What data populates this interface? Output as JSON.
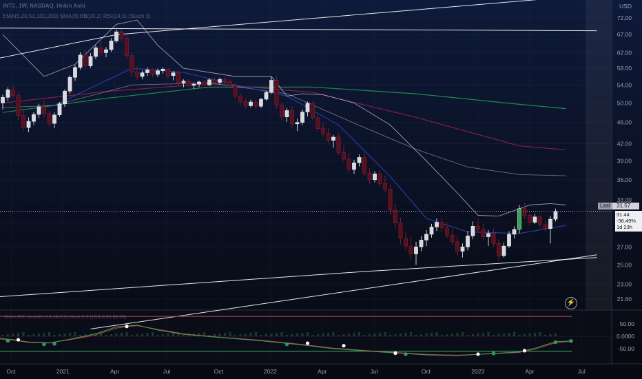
{
  "header": {
    "title": "INTC, 1W, NASDAQ, Hnkin Ashi",
    "indicators": "EMA(5,20,50,100,200) SMA(8) BB(20,2) RSI(14,5) (Stoch 3)",
    "osc_label": "Stoch RSI smooth (14,14,3,3) close 2.3 (16.4 0.00 50.00)"
  },
  "currency": "USD",
  "last_price": {
    "label": "Last",
    "value": "31.57"
  },
  "info_box": {
    "price": "31.44",
    "change": "-36.49%",
    "countdown": "1d 23h"
  },
  "y_ticks": [
    "72.00",
    "67.00",
    "62.00",
    "58.00",
    "54.00",
    "50.00",
    "46.00",
    "42.00",
    "39.00",
    "36.00",
    "33.00",
    "30.00",
    "27.00",
    "25.00",
    "23.00",
    "21.60"
  ],
  "y_tick_values": [
    72,
    67,
    62,
    58,
    54,
    50,
    46,
    42,
    39,
    36,
    33,
    30,
    27,
    25,
    23,
    21.6
  ],
  "osc_ticks": [
    "50.00",
    "0.0000",
    "-50.00"
  ],
  "x_ticks": [
    "Oct",
    "2021",
    "Apr",
    "Jul",
    "Oct",
    "2022",
    "Apr",
    "Jul",
    "Oct",
    "2023",
    "Apr",
    "Jul"
  ],
  "chart_data": {
    "type": "candlestick",
    "symbol": "INTC",
    "interval": "1W",
    "exchange": "NASDAQ",
    "price_scale": "log",
    "ylim": [
      20.6,
      77
    ],
    "x_start_week": 0,
    "candles": [
      [
        50.0,
        51.8,
        48.6,
        51.2
      ],
      [
        51.2,
        53.5,
        50.4,
        52.9
      ],
      [
        52.9,
        54.0,
        51.0,
        51.6
      ],
      [
        51.6,
        52.2,
        46.5,
        47.4
      ],
      [
        47.4,
        48.5,
        44.2,
        45.0
      ],
      [
        45.0,
        47.0,
        44.1,
        46.2
      ],
      [
        46.2,
        48.1,
        45.5,
        47.6
      ],
      [
        47.6,
        49.8,
        46.9,
        49.2
      ],
      [
        49.2,
        50.5,
        47.0,
        47.8
      ],
      [
        47.8,
        48.3,
        45.1,
        45.8
      ],
      [
        45.8,
        48.0,
        44.9,
        47.5
      ],
      [
        47.5,
        50.2,
        47.1,
        49.8
      ],
      [
        49.8,
        53.0,
        49.2,
        52.6
      ],
      [
        52.6,
        56.3,
        52.0,
        55.8
      ],
      [
        55.8,
        58.8,
        55.0,
        58.2
      ],
      [
        58.2,
        62.1,
        57.6,
        61.4
      ],
      [
        61.4,
        62.8,
        57.8,
        58.6
      ],
      [
        58.6,
        61.9,
        58.1,
        61.0
      ],
      [
        61.0,
        64.0,
        60.3,
        63.3
      ],
      [
        63.3,
        65.1,
        61.2,
        62.0
      ],
      [
        62.0,
        63.5,
        60.8,
        62.8
      ],
      [
        62.8,
        66.0,
        62.2,
        65.2
      ],
      [
        65.2,
        68.4,
        64.7,
        67.8
      ],
      [
        67.8,
        68.5,
        65.1,
        66.0
      ],
      [
        66.0,
        67.0,
        60.3,
        61.2
      ],
      [
        61.2,
        62.0,
        56.0,
        57.1
      ],
      [
        57.1,
        58.5,
        55.2,
        56.0
      ],
      [
        56.0,
        57.4,
        55.3,
        56.9
      ],
      [
        56.9,
        58.2,
        56.1,
        57.6
      ],
      [
        57.6,
        58.0,
        55.8,
        56.5
      ],
      [
        56.5,
        57.9,
        55.9,
        57.4
      ],
      [
        57.4,
        58.3,
        56.7,
        57.8
      ],
      [
        57.8,
        58.1,
        55.5,
        56.2
      ],
      [
        56.2,
        57.3,
        55.1,
        56.9
      ],
      [
        56.9,
        57.2,
        53.9,
        54.5
      ],
      [
        54.5,
        55.3,
        53.5,
        54.9
      ],
      [
        54.9,
        55.5,
        53.2,
        53.9
      ],
      [
        53.9,
        54.6,
        53.0,
        54.2
      ],
      [
        54.2,
        55.0,
        53.5,
        54.7
      ],
      [
        54.7,
        55.1,
        53.7,
        54.0
      ],
      [
        54.0,
        55.6,
        53.8,
        55.2
      ],
      [
        55.2,
        55.8,
        54.0,
        54.6
      ],
      [
        54.6,
        55.7,
        54.1,
        55.3
      ],
      [
        55.3,
        56.0,
        54.2,
        54.8
      ],
      [
        54.8,
        55.4,
        53.2,
        53.8
      ],
      [
        53.8,
        54.5,
        50.9,
        51.5
      ],
      [
        51.5,
        52.2,
        49.5,
        50.3
      ],
      [
        50.3,
        51.0,
        48.8,
        49.4
      ],
      [
        49.4,
        50.7,
        49.0,
        50.2
      ],
      [
        50.2,
        50.8,
        48.7,
        49.3
      ],
      [
        49.3,
        51.1,
        48.9,
        50.8
      ],
      [
        50.8,
        52.7,
        50.5,
        52.3
      ],
      [
        52.3,
        55.9,
        52.0,
        55.1
      ],
      [
        55.1,
        56.1,
        48.8,
        49.6
      ],
      [
        49.6,
        50.1,
        46.4,
        47.1
      ],
      [
        47.1,
        48.9,
        46.1,
        48.4
      ],
      [
        48.4,
        49.3,
        44.8,
        45.7
      ],
      [
        45.7,
        46.7,
        44.3,
        46.0
      ],
      [
        46.0,
        48.6,
        45.5,
        48.1
      ],
      [
        48.1,
        50.3,
        47.2,
        49.9
      ],
      [
        49.9,
        50.4,
        46.4,
        46.9
      ],
      [
        46.9,
        47.6,
        44.2,
        44.8
      ],
      [
        44.8,
        45.9,
        43.3,
        43.9
      ],
      [
        43.9,
        44.9,
        41.9,
        42.6
      ],
      [
        42.6,
        43.6,
        41.3,
        43.2
      ],
      [
        43.2,
        43.9,
        40.0,
        40.4
      ],
      [
        40.4,
        41.7,
        38.9,
        39.3
      ],
      [
        39.3,
        40.3,
        37.1,
        37.6
      ],
      [
        37.6,
        39.2,
        36.9,
        38.7
      ],
      [
        38.7,
        40.1,
        38.1,
        39.6
      ],
      [
        39.6,
        40.5,
        36.6,
        37.0
      ],
      [
        37.0,
        37.8,
        35.3,
        36.0
      ],
      [
        36.0,
        37.3,
        35.6,
        36.9
      ],
      [
        36.9,
        37.6,
        34.9,
        35.4
      ],
      [
        35.4,
        36.7,
        34.1,
        34.6
      ],
      [
        34.6,
        35.3,
        31.0,
        31.6
      ],
      [
        31.6,
        32.5,
        29.2,
        29.9
      ],
      [
        29.9,
        30.6,
        27.3,
        28.0
      ],
      [
        28.0,
        28.9,
        26.6,
        27.1
      ],
      [
        27.1,
        28.1,
        25.5,
        26.2
      ],
      [
        26.2,
        27.6,
        25.0,
        27.0
      ],
      [
        27.0,
        28.3,
        26.5,
        27.8
      ],
      [
        27.8,
        29.0,
        27.1,
        28.5
      ],
      [
        28.5,
        29.8,
        28.1,
        29.4
      ],
      [
        29.4,
        30.5,
        28.9,
        30.0
      ],
      [
        30.0,
        30.6,
        28.8,
        29.3
      ],
      [
        29.3,
        29.9,
        28.0,
        28.4
      ],
      [
        28.4,
        29.2,
        27.2,
        27.6
      ],
      [
        27.6,
        28.3,
        26.0,
        26.5
      ],
      [
        26.5,
        27.4,
        25.8,
        27.0
      ],
      [
        27.0,
        28.9,
        26.6,
        28.3
      ],
      [
        28.3,
        30.1,
        27.9,
        29.5
      ],
      [
        29.5,
        30.4,
        28.7,
        29.1
      ],
      [
        29.1,
        29.8,
        27.8,
        28.2
      ],
      [
        28.2,
        29.0,
        27.1,
        28.6
      ],
      [
        28.6,
        29.2,
        27.0,
        27.4
      ],
      [
        27.4,
        27.9,
        25.4,
        26.0
      ],
      [
        26.0,
        27.5,
        25.8,
        27.1
      ],
      [
        27.1,
        28.9,
        26.9,
        28.5
      ],
      [
        28.5,
        29.5,
        28.0,
        29.1
      ],
      [
        29.1,
        32.3,
        28.6,
        31.8
      ],
      [
        31.8,
        32.6,
        30.4,
        30.9
      ],
      [
        30.9,
        31.2,
        29.6,
        30.0
      ],
      [
        30.0,
        31.1,
        29.8,
        30.7
      ],
      [
        30.7,
        31.0,
        29.3,
        29.7
      ],
      [
        29.7,
        30.2,
        28.9,
        29.2
      ],
      [
        29.2,
        30.8,
        27.4,
        30.4
      ],
      [
        30.4,
        31.8,
        30.1,
        31.44
      ]
    ],
    "series": [
      {
        "kind": "ema-200",
        "values": [
          [
            0,
            48.0
          ],
          [
            20,
            51.0
          ],
          [
            40,
            53.5
          ],
          [
            60,
            53.5
          ],
          [
            80,
            52.0
          ],
          [
            100,
            49.7
          ],
          [
            109,
            48.8
          ]
        ]
      },
      {
        "kind": "ema-100",
        "values": [
          [
            0,
            50.0
          ],
          [
            20,
            52.5
          ],
          [
            40,
            54.3
          ],
          [
            60,
            52.3
          ],
          [
            80,
            47.0
          ],
          [
            100,
            41.6
          ],
          [
            109,
            40.9
          ]
        ]
      },
      {
        "kind": "ema-50",
        "values": [
          [
            0,
            49.0
          ],
          [
            10,
            49.5
          ],
          [
            25,
            54.0
          ],
          [
            40,
            54.5
          ],
          [
            55,
            52.0
          ],
          [
            70,
            45.0
          ],
          [
            80,
            41.0
          ],
          [
            90,
            38.0
          ],
          [
            100,
            36.8
          ],
          [
            109,
            36.6
          ]
        ]
      },
      {
        "kind": "ema-20",
        "values": [
          [
            10,
            49.5
          ],
          [
            25,
            58.0
          ],
          [
            35,
            57.0
          ],
          [
            45,
            54.0
          ],
          [
            55,
            51.5
          ],
          [
            65,
            45.5
          ],
          [
            75,
            36.5
          ],
          [
            82,
            30.5
          ],
          [
            90,
            28.8
          ],
          [
            100,
            28.6
          ],
          [
            109,
            29.6
          ]
        ]
      },
      {
        "kind": "bb-upper",
        "values": [
          [
            0,
            67.0
          ],
          [
            8,
            56.0
          ],
          [
            14,
            59.0
          ],
          [
            22,
            70.0
          ],
          [
            26,
            71.3
          ],
          [
            30,
            64.0
          ],
          [
            35,
            58.0
          ],
          [
            45,
            56.0
          ],
          [
            52,
            56.0
          ],
          [
            55,
            51.5
          ],
          [
            58,
            52.0
          ],
          [
            62,
            51.8
          ],
          [
            68,
            50.0
          ],
          [
            75,
            45.5
          ],
          [
            82,
            39.0
          ],
          [
            88,
            34.0
          ],
          [
            92,
            30.9
          ],
          [
            96,
            30.8
          ],
          [
            102,
            32.3
          ],
          [
            106,
            32.5
          ],
          [
            109,
            32.3
          ]
        ]
      },
      {
        "kind": "channel-upper",
        "values": [
          [
            -1,
            60.5
          ],
          [
            22,
            67.0
          ],
          [
            50,
            70.5
          ],
          [
            80,
            74.5
          ],
          [
            115,
            79.5
          ]
        ]
      },
      {
        "kind": "horizontal",
        "values": [
          [
            -1,
            68.9
          ],
          [
            115,
            68.1
          ]
        ]
      },
      {
        "kind": "channel-lower",
        "values": [
          [
            -1,
            21.8
          ],
          [
            70,
            24.3
          ],
          [
            115,
            25.8
          ]
        ]
      },
      {
        "kind": "support",
        "values": [
          [
            17,
            19.0
          ],
          [
            115,
            26.1
          ]
        ]
      }
    ],
    "stoch_rsi": {
      "ylim": [
        -100,
        100
      ],
      "levels": [
        80,
        -60
      ],
      "k": [
        [
          -1,
          -10
        ],
        [
          2,
          -15
        ],
        [
          5,
          -25
        ],
        [
          9,
          -27
        ],
        [
          13,
          -12
        ],
        [
          18,
          10
        ],
        [
          22,
          38
        ],
        [
          26,
          45
        ],
        [
          30,
          25
        ],
        [
          35,
          8
        ],
        [
          42,
          -5
        ],
        [
          50,
          -18
        ],
        [
          58,
          -35
        ],
        [
          64,
          -50
        ],
        [
          72,
          -62
        ],
        [
          82,
          -75
        ],
        [
          88,
          -78
        ],
        [
          94,
          -70
        ],
        [
          100,
          -63
        ],
        [
          103,
          -48
        ],
        [
          107,
          -22
        ],
        [
          110,
          -19
        ]
      ],
      "d": [
        [
          -1,
          -8
        ],
        [
          2,
          -13
        ],
        [
          5,
          -23
        ],
        [
          9,
          -26
        ],
        [
          13,
          -14
        ],
        [
          18,
          5
        ],
        [
          22,
          33
        ],
        [
          26,
          43
        ],
        [
          30,
          28
        ],
        [
          35,
          10
        ],
        [
          42,
          -4
        ],
        [
          50,
          -16
        ],
        [
          58,
          -33
        ],
        [
          64,
          -48
        ],
        [
          72,
          -60
        ],
        [
          82,
          -73
        ],
        [
          88,
          -76
        ],
        [
          94,
          -71
        ],
        [
          100,
          -65
        ],
        [
          103,
          -52
        ],
        [
          107,
          -26
        ],
        [
          110,
          -20
        ]
      ],
      "green_dots": [
        [
          1,
          -18
        ],
        [
          8,
          -32
        ],
        [
          10,
          -30
        ],
        [
          55,
          -32
        ],
        [
          78,
          -72
        ],
        [
          95,
          -69
        ],
        [
          107,
          -24
        ],
        [
          110,
          -19
        ]
      ],
      "white_dots": [
        [
          3,
          -14
        ],
        [
          24,
          40
        ],
        [
          59,
          -28
        ],
        [
          66,
          -38
        ],
        [
          76,
          -68
        ],
        [
          92,
          -72
        ],
        [
          101,
          -58
        ]
      ]
    }
  }
}
